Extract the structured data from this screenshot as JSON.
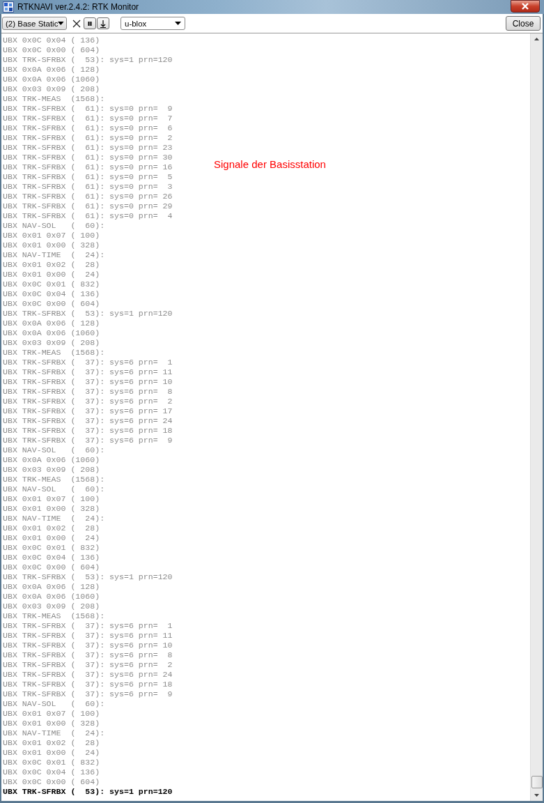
{
  "window": {
    "title": "RTKNAVI ver.2.4.2: RTK Monitor"
  },
  "toolbar": {
    "stream_select": {
      "value": "(2) Base Static"
    },
    "format_select": {
      "value": "u-blox"
    },
    "close_button": {
      "label": "Close"
    }
  },
  "annotation": {
    "text": "Signale der Basisstation"
  },
  "log": {
    "lines": [
      {
        "text": "UBX 0x0C 0x04 ( 136)",
        "current": false
      },
      {
        "text": "UBX 0x0C 0x00 ( 604)",
        "current": false
      },
      {
        "text": "UBX TRK-SFRBX (  53): sys=1 prn=120",
        "current": false
      },
      {
        "text": "UBX 0x0A 0x06 ( 128)",
        "current": false
      },
      {
        "text": "UBX 0x0A 0x06 (1060)",
        "current": false
      },
      {
        "text": "UBX 0x03 0x09 ( 208)",
        "current": false
      },
      {
        "text": "UBX TRK-MEAS  (1568):",
        "current": false
      },
      {
        "text": "UBX TRK-SFRBX (  61): sys=0 prn=  9",
        "current": false
      },
      {
        "text": "UBX TRK-SFRBX (  61): sys=0 prn=  7",
        "current": false
      },
      {
        "text": "UBX TRK-SFRBX (  61): sys=0 prn=  6",
        "current": false
      },
      {
        "text": "UBX TRK-SFRBX (  61): sys=0 prn=  2",
        "current": false
      },
      {
        "text": "UBX TRK-SFRBX (  61): sys=0 prn= 23",
        "current": false
      },
      {
        "text": "UBX TRK-SFRBX (  61): sys=0 prn= 30",
        "current": false
      },
      {
        "text": "UBX TRK-SFRBX (  61): sys=0 prn= 16",
        "current": false
      },
      {
        "text": "UBX TRK-SFRBX (  61): sys=0 prn=  5",
        "current": false
      },
      {
        "text": "UBX TRK-SFRBX (  61): sys=0 prn=  3",
        "current": false
      },
      {
        "text": "UBX TRK-SFRBX (  61): sys=0 prn= 26",
        "current": false
      },
      {
        "text": "UBX TRK-SFRBX (  61): sys=0 prn= 29",
        "current": false
      },
      {
        "text": "UBX TRK-SFRBX (  61): sys=0 prn=  4",
        "current": false
      },
      {
        "text": "UBX NAV-SOL   (  60):",
        "current": false
      },
      {
        "text": "UBX 0x01 0x07 ( 100)",
        "current": false
      },
      {
        "text": "UBX 0x01 0x00 ( 328)",
        "current": false
      },
      {
        "text": "UBX NAV-TIME  (  24):",
        "current": false
      },
      {
        "text": "UBX 0x01 0x02 (  28)",
        "current": false
      },
      {
        "text": "UBX 0x01 0x00 (  24)",
        "current": false
      },
      {
        "text": "UBX 0x0C 0x01 ( 832)",
        "current": false
      },
      {
        "text": "UBX 0x0C 0x04 ( 136)",
        "current": false
      },
      {
        "text": "UBX 0x0C 0x00 ( 604)",
        "current": false
      },
      {
        "text": "UBX TRK-SFRBX (  53): sys=1 prn=120",
        "current": false
      },
      {
        "text": "UBX 0x0A 0x06 ( 128)",
        "current": false
      },
      {
        "text": "UBX 0x0A 0x06 (1060)",
        "current": false
      },
      {
        "text": "UBX 0x03 0x09 ( 208)",
        "current": false
      },
      {
        "text": "UBX TRK-MEAS  (1568):",
        "current": false
      },
      {
        "text": "UBX TRK-SFRBX (  37): sys=6 prn=  1",
        "current": false
      },
      {
        "text": "UBX TRK-SFRBX (  37): sys=6 prn= 11",
        "current": false
      },
      {
        "text": "UBX TRK-SFRBX (  37): sys=6 prn= 10",
        "current": false
      },
      {
        "text": "UBX TRK-SFRBX (  37): sys=6 prn=  8",
        "current": false
      },
      {
        "text": "UBX TRK-SFRBX (  37): sys=6 prn=  2",
        "current": false
      },
      {
        "text": "UBX TRK-SFRBX (  37): sys=6 prn= 17",
        "current": false
      },
      {
        "text": "UBX TRK-SFRBX (  37): sys=6 prn= 24",
        "current": false
      },
      {
        "text": "UBX TRK-SFRBX (  37): sys=6 prn= 18",
        "current": false
      },
      {
        "text": "UBX TRK-SFRBX (  37): sys=6 prn=  9",
        "current": false
      },
      {
        "text": "UBX NAV-SOL   (  60):",
        "current": false
      },
      {
        "text": "UBX 0x0A 0x06 (1060)",
        "current": false
      },
      {
        "text": "UBX 0x03 0x09 ( 208)",
        "current": false
      },
      {
        "text": "UBX TRK-MEAS  (1568):",
        "current": false
      },
      {
        "text": "UBX NAV-SOL   (  60):",
        "current": false
      },
      {
        "text": "UBX 0x01 0x07 ( 100)",
        "current": false
      },
      {
        "text": "UBX 0x01 0x00 ( 328)",
        "current": false
      },
      {
        "text": "UBX NAV-TIME  (  24):",
        "current": false
      },
      {
        "text": "UBX 0x01 0x02 (  28)",
        "current": false
      },
      {
        "text": "UBX 0x01 0x00 (  24)",
        "current": false
      },
      {
        "text": "UBX 0x0C 0x01 ( 832)",
        "current": false
      },
      {
        "text": "UBX 0x0C 0x04 ( 136)",
        "current": false
      },
      {
        "text": "UBX 0x0C 0x00 ( 604)",
        "current": false
      },
      {
        "text": "UBX TRK-SFRBX (  53): sys=1 prn=120",
        "current": false
      },
      {
        "text": "UBX 0x0A 0x06 ( 128)",
        "current": false
      },
      {
        "text": "UBX 0x0A 0x06 (1060)",
        "current": false
      },
      {
        "text": "UBX 0x03 0x09 ( 208)",
        "current": false
      },
      {
        "text": "UBX TRK-MEAS  (1568):",
        "current": false
      },
      {
        "text": "UBX TRK-SFRBX (  37): sys=6 prn=  1",
        "current": false
      },
      {
        "text": "UBX TRK-SFRBX (  37): sys=6 prn= 11",
        "current": false
      },
      {
        "text": "UBX TRK-SFRBX (  37): sys=6 prn= 10",
        "current": false
      },
      {
        "text": "UBX TRK-SFRBX (  37): sys=6 prn=  8",
        "current": false
      },
      {
        "text": "UBX TRK-SFRBX (  37): sys=6 prn=  2",
        "current": false
      },
      {
        "text": "UBX TRK-SFRBX (  37): sys=6 prn= 24",
        "current": false
      },
      {
        "text": "UBX TRK-SFRBX (  37): sys=6 prn= 18",
        "current": false
      },
      {
        "text": "UBX TRK-SFRBX (  37): sys=6 prn=  9",
        "current": false
      },
      {
        "text": "UBX NAV-SOL   (  60):",
        "current": false
      },
      {
        "text": "UBX 0x01 0x07 ( 100)",
        "current": false
      },
      {
        "text": "UBX 0x01 0x00 ( 328)",
        "current": false
      },
      {
        "text": "UBX NAV-TIME  (  24):",
        "current": false
      },
      {
        "text": "UBX 0x01 0x02 (  28)",
        "current": false
      },
      {
        "text": "UBX 0x01 0x00 (  24)",
        "current": false
      },
      {
        "text": "UBX 0x0C 0x01 ( 832)",
        "current": false
      },
      {
        "text": "UBX 0x0C 0x04 ( 136)",
        "current": false
      },
      {
        "text": "UBX 0x0C 0x00 ( 604)",
        "current": false
      },
      {
        "text": "UBX TRK-SFRBX (  53): sys=1 prn=120",
        "current": true
      }
    ]
  }
}
